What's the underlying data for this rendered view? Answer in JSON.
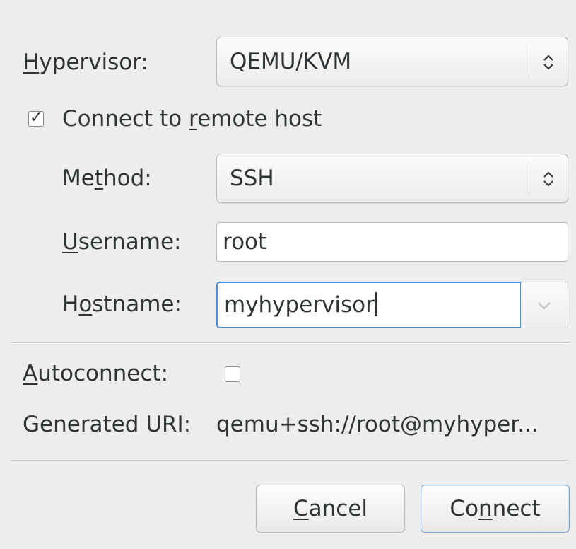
{
  "hypervisor": {
    "label_mnemonic": "H",
    "label_rest": "ypervisor:",
    "value": "QEMU/KVM"
  },
  "remote": {
    "label_prefix": "Connect to ",
    "label_mnemonic": "r",
    "label_rest": "emote host",
    "checked": true,
    "check_glyph": "✓"
  },
  "method": {
    "label_prefix": "Me",
    "label_mnemonic": "t",
    "label_rest": "hod:",
    "value": "SSH"
  },
  "username": {
    "label_mnemonic": "U",
    "label_rest": "sername:",
    "value": "root"
  },
  "hostname": {
    "label_prefix": "H",
    "label_mnemonic": "o",
    "label_rest": "stname:",
    "value": "myhypervisor"
  },
  "autoconnect": {
    "label_mnemonic": "A",
    "label_rest": "utoconnect:",
    "checked": false
  },
  "generated_uri": {
    "label": "Generated URI:",
    "value": "qemu+ssh://root@myhyper..."
  },
  "buttons": {
    "cancel": {
      "mnemonic": "C",
      "rest": "ancel"
    },
    "connect": {
      "prefix": "Co",
      "mnemonic": "n",
      "rest": "nect"
    }
  },
  "colors": {
    "focus_border": "#4a90d9",
    "default_button_border": "#7ea5cf",
    "background": "#ededed"
  }
}
